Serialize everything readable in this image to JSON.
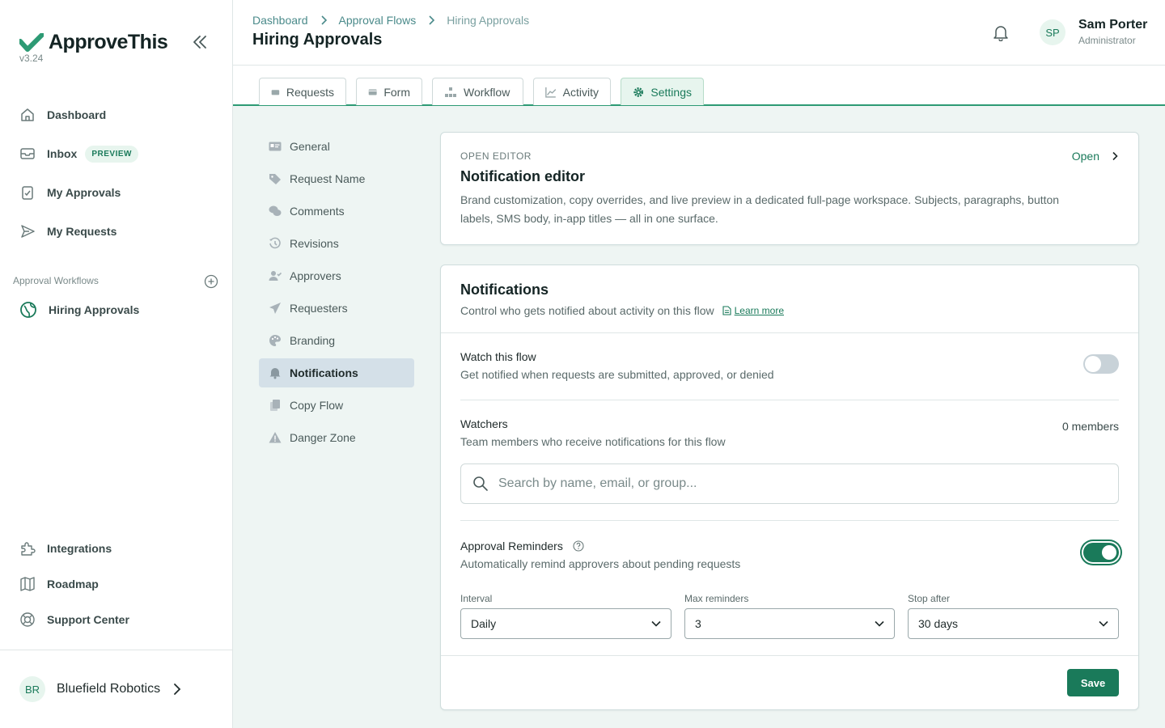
{
  "app": {
    "name": "ApproveThis",
    "version": "v3.24"
  },
  "sidebar": {
    "items": [
      {
        "label": "Dashboard"
      },
      {
        "label": "Inbox",
        "badge": "PREVIEW"
      },
      {
        "label": "My Approvals"
      },
      {
        "label": "My Requests"
      }
    ],
    "section_label": "Approval Workflows",
    "flows": [
      {
        "label": "Hiring Approvals"
      }
    ],
    "bottom_items": [
      {
        "label": "Integrations"
      },
      {
        "label": "Roadmap"
      },
      {
        "label": "Support Center"
      }
    ],
    "org": {
      "initials": "BR",
      "name": "Bluefield Robotics"
    }
  },
  "header": {
    "breadcrumb": [
      "Dashboard",
      "Approval Flows",
      "Hiring Approvals"
    ],
    "title": "Hiring Approvals",
    "user": {
      "initials": "SP",
      "name": "Sam Porter",
      "role": "Administrator"
    }
  },
  "tabs": [
    {
      "label": "Requests",
      "icon": "inbox-icon"
    },
    {
      "label": "Form",
      "icon": "form-icon"
    },
    {
      "label": "Workflow",
      "icon": "workflow-icon"
    },
    {
      "label": "Activity",
      "icon": "chart-icon"
    },
    {
      "label": "Settings",
      "icon": "gear-icon",
      "active": true
    }
  ],
  "settings_nav": [
    {
      "label": "General"
    },
    {
      "label": "Request Name"
    },
    {
      "label": "Comments"
    },
    {
      "label": "Revisions"
    },
    {
      "label": "Approvers"
    },
    {
      "label": "Requesters"
    },
    {
      "label": "Branding"
    },
    {
      "label": "Notifications",
      "active": true
    },
    {
      "label": "Copy Flow"
    },
    {
      "label": "Danger Zone"
    }
  ],
  "editor_card": {
    "eyebrow": "OPEN EDITOR",
    "title": "Notification editor",
    "description": "Brand customization, copy overrides, and live preview in a dedicated full-page workspace. Subjects, paragraphs, button labels, SMS body, in-app titles — all in one surface.",
    "open_label": "Open"
  },
  "notifications": {
    "title": "Notifications",
    "subtitle": "Control who gets notified about activity on this flow",
    "learn_more": "Learn more",
    "watch": {
      "title": "Watch this flow",
      "desc": "Get notified when requests are submitted, approved, or denied",
      "enabled": false
    },
    "watchers": {
      "title": "Watchers",
      "desc": "Team members who receive notifications for this flow",
      "count": "0 members",
      "search_placeholder": "Search by name, email, or group..."
    },
    "reminders": {
      "title": "Approval Reminders",
      "desc": "Automatically remind approvers about pending requests",
      "enabled": true
    },
    "fields": [
      {
        "label": "Interval",
        "value": "Daily"
      },
      {
        "label": "Max reminders",
        "value": "3"
      },
      {
        "label": "Stop after",
        "value": "30 days"
      }
    ],
    "save_label": "Save"
  },
  "colors": {
    "accent": "#1a7a5a",
    "tab_border": "#2d9a74",
    "main_bg": "#eef5f3"
  }
}
